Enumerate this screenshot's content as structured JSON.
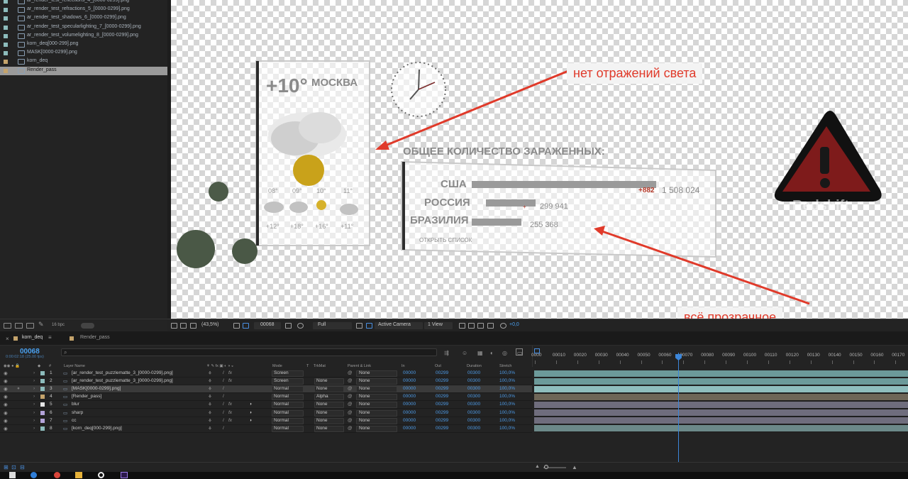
{
  "project": {
    "items": [
      {
        "name": "ar_render_test_reflections_4_[0000-0299].png",
        "color": "#8dbcbc",
        "type": "footage"
      },
      {
        "name": "ar_render_test_refractions_5_[0000-0299].png",
        "color": "#8dbcbc",
        "type": "footage"
      },
      {
        "name": "ar_render_test_shadows_6_[0000-0299].png",
        "color": "#8dbcbc",
        "type": "footage"
      },
      {
        "name": "ar_render_test_specularlighting_7_[0000-0299].png",
        "color": "#8dbcbc",
        "type": "footage"
      },
      {
        "name": "ar_render_test_volumelighting_8_[0000-0299].png",
        "color": "#8dbcbc",
        "type": "footage"
      },
      {
        "name": "korn_deq[000-299].png",
        "color": "#8dbcbc",
        "type": "footage"
      },
      {
        "name": "MASK[0000-0299].png",
        "color": "#8dbcbc",
        "type": "footage"
      },
      {
        "name": "korn_deq",
        "color": "#c4a36b",
        "type": "comp"
      },
      {
        "name": "Render_pass",
        "color": "#c4a36b",
        "type": "comp",
        "selected": true
      }
    ],
    "bpc_label": "16 bpc"
  },
  "viewer": {
    "weather": {
      "temp": "+10°",
      "city": "МОСКВА",
      "times": [
        "08°",
        "09°",
        "10°",
        "11°"
      ],
      "temps": [
        "+12°",
        "+18°",
        "+16°",
        "+11°"
      ]
    },
    "stats": {
      "title": "ОБЩЕЕ КОЛИЧЕСТВО ЗАРАЖЕННЫХ:",
      "rows": [
        {
          "country": "США",
          "value": "1 508 024",
          "delta": "+882",
          "fraction": 1.0
        },
        {
          "country": "РОССИЯ",
          "value": "299 941",
          "delta": "+",
          "fraction": 0.27
        },
        {
          "country": "БРАЗИЛИЯ",
          "value": "255 368",
          "delta": "",
          "fraction": 0.27
        }
      ],
      "link": "ОТКРЫТЬ СПИСОК"
    },
    "watermark": "Redshift",
    "callouts": {
      "top": "нет отражений света",
      "bottom": "всё прозрачное"
    }
  },
  "viewer_toolbar": {
    "zoom": "(43,5%)",
    "frame": "00068",
    "resolution": "Full",
    "camera": "Active Camera",
    "views": "1 View",
    "exposure": "+0,0"
  },
  "timeline_tabs": {
    "active": "korn_deq",
    "other": "Render_pass"
  },
  "timeline": {
    "timecode": "00068",
    "timecode_sub": "0:00:02:18 (25.00 fps)",
    "columns": {
      "layer_name": "Layer Name",
      "mode": "Mode",
      "t": "T",
      "trkmat": "TrkMat",
      "parent": "Parent & Link",
      "in": "In",
      "out": "Out",
      "duration": "Duration",
      "stretch": "Stretch"
    },
    "layers": [
      {
        "num": "1",
        "name": "[ar_render_test_puzzlematte_3_[0000-0299].png]",
        "color": "#8dbcbc",
        "fx": true,
        "mode": "Screen",
        "trkmat": "",
        "parent": "None",
        "in": "00000",
        "out": "00299",
        "duration": "00300",
        "stretch": "100,0%"
      },
      {
        "num": "2",
        "name": "[ar_render_test_puzzlematte_3_[0000-0299].png]",
        "color": "#8dbcbc",
        "fx": true,
        "mode": "Screen",
        "trkmat": "None",
        "parent": "None",
        "in": "00000",
        "out": "00299",
        "duration": "00300",
        "stretch": "100,0%"
      },
      {
        "num": "3",
        "name": "[MASK[0000-0299].png]",
        "color": "#8dbcbc",
        "fx": false,
        "mode": "Normal",
        "trkmat": "None",
        "parent": "None",
        "in": "00000",
        "out": "00299",
        "duration": "00300",
        "stretch": "100,0%",
        "selected": true
      },
      {
        "num": "4",
        "name": "[Render_pass]",
        "color": "#c4a36b",
        "fx": false,
        "mode": "Normal",
        "trkmat": "Alpha",
        "parent": "None",
        "in": "00000",
        "out": "00299",
        "duration": "00300",
        "stretch": "100,0%"
      },
      {
        "num": "5",
        "name": "blur",
        "color": "#e6e6e6",
        "fx": true,
        "mode": "Normal",
        "trkmat": "None",
        "parent": "None",
        "in": "00000",
        "out": "00299",
        "duration": "00300",
        "stretch": "100,0%"
      },
      {
        "num": "6",
        "name": "sharp",
        "color": "#b3a3d9",
        "fx": true,
        "mode": "Normal",
        "trkmat": "None",
        "parent": "None",
        "in": "00000",
        "out": "00299",
        "duration": "00300",
        "stretch": "100,0%"
      },
      {
        "num": "7",
        "name": "cc",
        "color": "#b3a3d9",
        "fx": true,
        "mode": "Normal",
        "trkmat": "None",
        "parent": "None",
        "in": "00000",
        "out": "00299",
        "duration": "00300",
        "stretch": "100,0%"
      },
      {
        "num": "8",
        "name": "[korn_deq[000-299].png]",
        "color": "#8dbcbc",
        "fx": false,
        "mode": "Normal",
        "trkmat": "None",
        "parent": "None",
        "in": "00000",
        "out": "00299",
        "duration": "00300",
        "stretch": "100,0%"
      }
    ],
    "ruler": [
      "0000",
      "00010",
      "00020",
      "00030",
      "00040",
      "00050",
      "00060",
      "00070",
      "00080",
      "00090",
      "00100",
      "00110",
      "00120",
      "00130",
      "00140",
      "00150",
      "00160",
      "00170"
    ],
    "bar_colors": [
      "#6c9a9a",
      "#6c9a9a",
      "#8fbdbd",
      "#6e6658",
      "#6f6d7d",
      "#6f6d7d",
      "#6f6d7d",
      "#6c8989"
    ]
  }
}
